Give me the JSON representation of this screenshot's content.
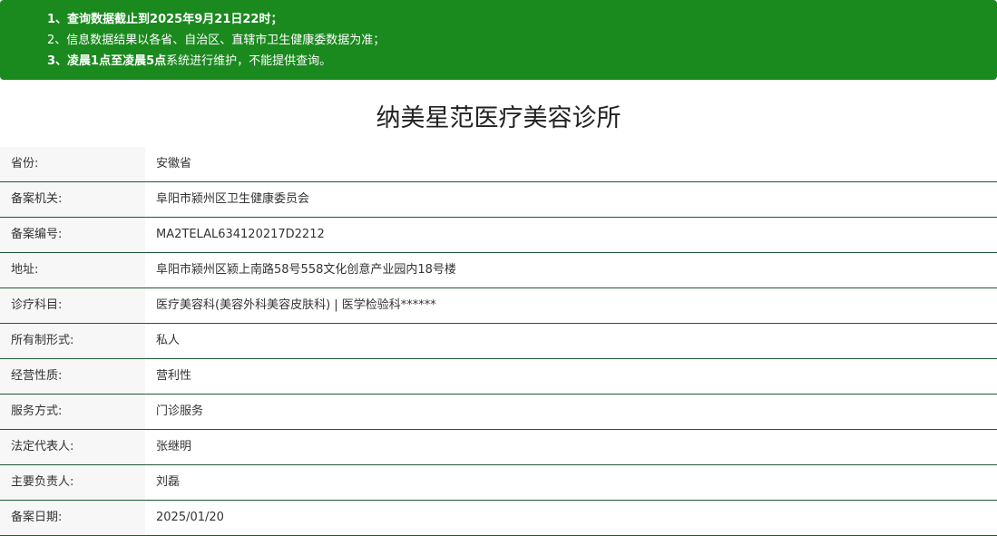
{
  "notice": {
    "line1": "1、查询数据截止到2025年9月21日22时；",
    "line2": "2、信息数据结果以各省、自治区、直辖市卫生健康委数据为准；",
    "line3_bold": "3、凌晨1点至凌晨5点",
    "line3_rest": "系统进行维护，不能提供查询。"
  },
  "title": "纳美星范医疗美容诊所",
  "fields": [
    {
      "label": "省份:",
      "value": "安徽省"
    },
    {
      "label": "备案机关:",
      "value": "阜阳市颍州区卫生健康委员会"
    },
    {
      "label": "备案编号:",
      "value": "MA2TELAL634120217D2212"
    },
    {
      "label": "地址:",
      "value": "阜阳市颍州区颍上南路58号558文化创意产业园内18号楼"
    },
    {
      "label": "诊疗科目:",
      "value": "医疗美容科(美容外科美容皮肤科) | 医学检验科******"
    },
    {
      "label": "所有制形式:",
      "value": "私人"
    },
    {
      "label": "经营性质:",
      "value": "营利性"
    },
    {
      "label": "服务方式:",
      "value": "门诊服务"
    },
    {
      "label": "法定代表人:",
      "value": "张继明"
    },
    {
      "label": "主要负责人:",
      "value": "刘磊"
    },
    {
      "label": "备案日期:",
      "value": "2025/01/20"
    }
  ],
  "colors": {
    "notice_background": "#1a891e",
    "row_border": "#1e5a32",
    "label_background": "#f7f7f7"
  }
}
